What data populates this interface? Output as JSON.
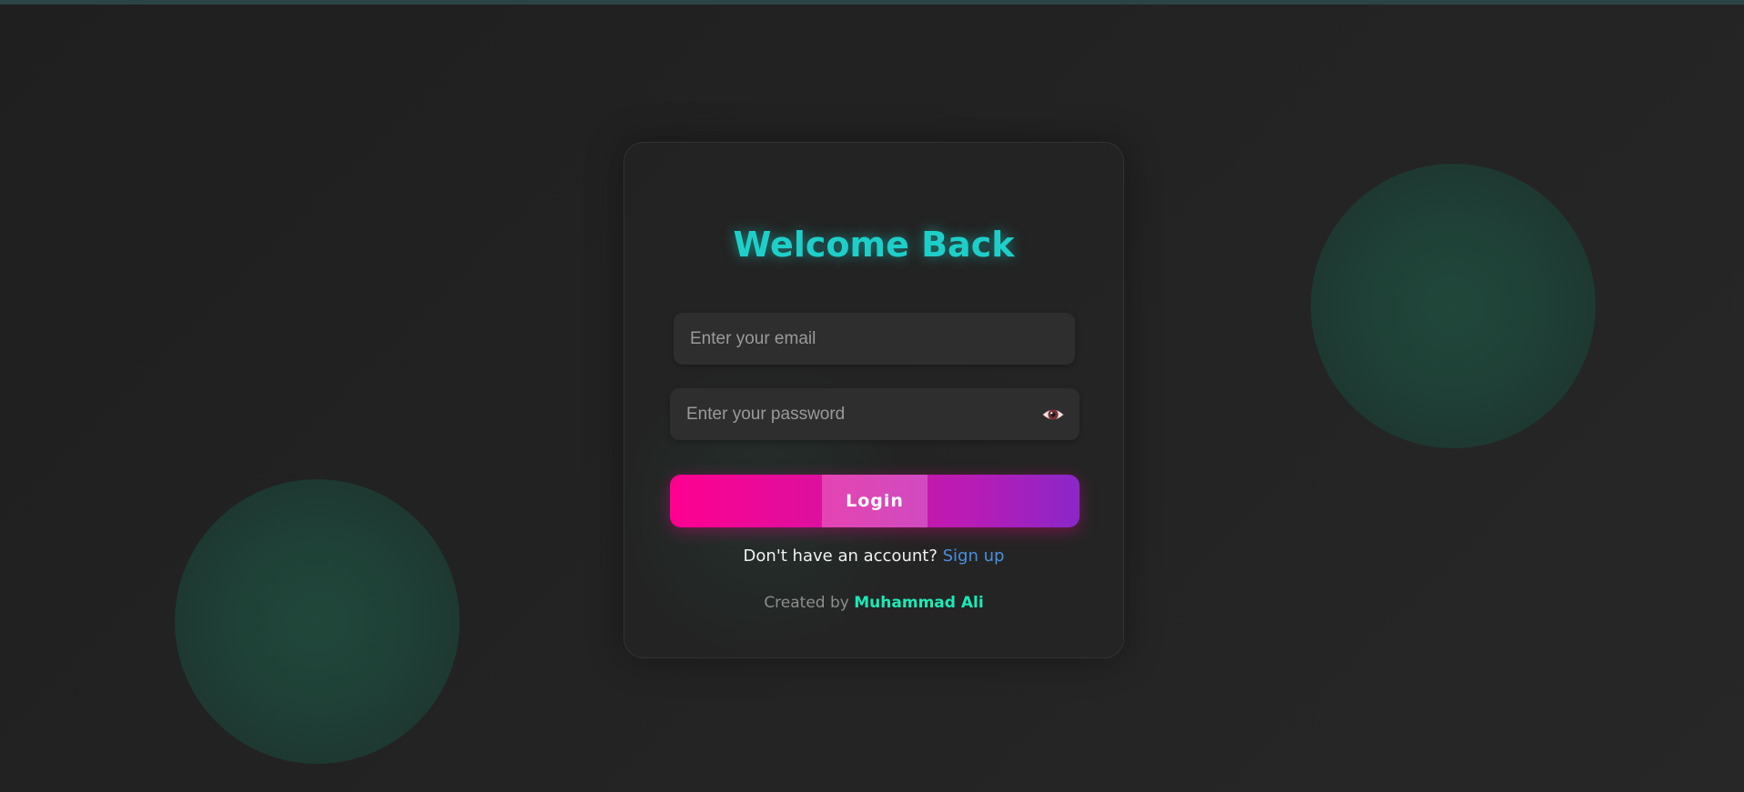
{
  "login_card": {
    "title": "Welcome Back",
    "email_placeholder": "Enter your email",
    "password_placeholder": "Enter your password",
    "toggle_password_icon": "eye-icon",
    "login_label": "Login",
    "signup_prompt": "Don't have an account?",
    "signup_link": "Sign up",
    "credit_prefix": "Created by",
    "credit_author": "Muhammad Ali"
  },
  "colors": {
    "title": "#1ecfc9",
    "button_start": "#ff0090",
    "button_end": "#8a27c9",
    "link": "#4b8fe0",
    "author": "#1de9b6",
    "background": "#232323",
    "orb": "#20473b"
  }
}
